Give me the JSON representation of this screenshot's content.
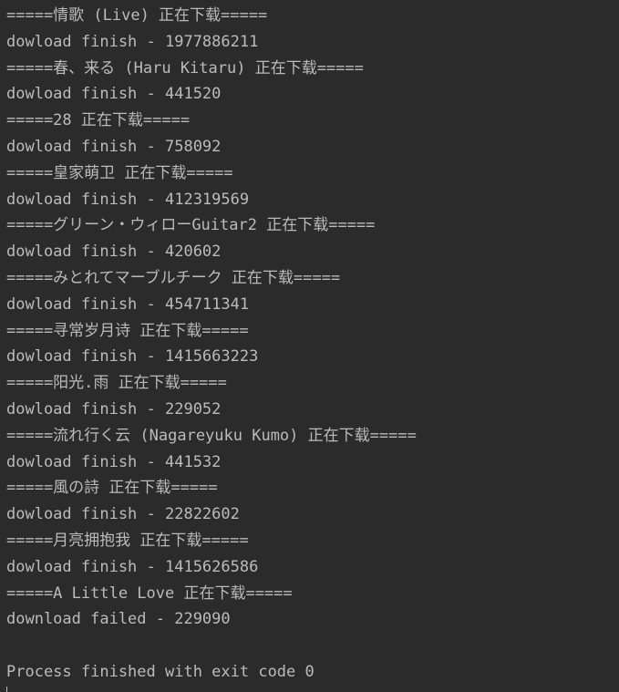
{
  "console": {
    "lines": [
      "=====情歌 (Live) 正在下载=====",
      "dowload finish - 1977886211",
      "=====春、来る (Haru Kitaru) 正在下载=====",
      "dowload finish - 441520",
      "=====28 正在下载=====",
      "dowload finish - 758092",
      "=====皇家萌卫 正在下载=====",
      "dowload finish - 412319569",
      "=====グリーン・ウィローGuitar2 正在下载=====",
      "dowload finish - 420602",
      "=====みとれてマーブルチーク 正在下载=====",
      "dowload finish - 454711341",
      "=====寻常岁月诗 正在下载=====",
      "dowload finish - 1415663223",
      "=====阳光.雨 正在下载=====",
      "dowload finish - 229052",
      "=====流れ行く云 (Nagareyuku Kumo) 正在下载=====",
      "dowload finish - 441532",
      "=====風の詩 正在下载=====",
      "dowload finish - 22822602",
      "=====月亮拥抱我 正在下载=====",
      "dowload finish - 1415626586",
      "=====A Little Love 正在下载=====",
      "download failed - 229090",
      "",
      "Process finished with exit code 0"
    ]
  },
  "colors": {
    "background": "#2b2b2b",
    "text": "#bbbbbb"
  }
}
